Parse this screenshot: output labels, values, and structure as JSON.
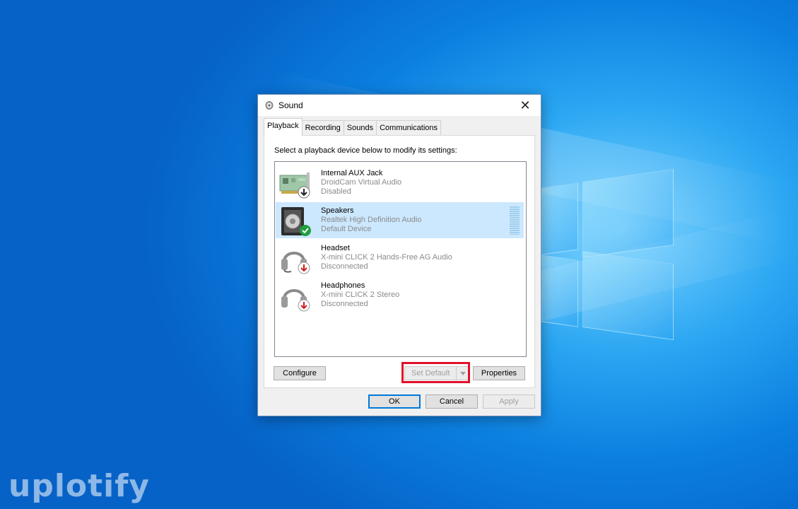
{
  "window": {
    "title": "Sound",
    "close_glyph": "✕"
  },
  "tabs": [
    {
      "label": "Playback",
      "active": true
    },
    {
      "label": "Recording",
      "active": false
    },
    {
      "label": "Sounds",
      "active": false
    },
    {
      "label": "Communications",
      "active": false
    }
  ],
  "instruction": "Select a playback device below to modify its settings:",
  "devices": [
    {
      "name": "Internal AUX Jack",
      "driver": "DroidCam Virtual Audio",
      "status": "Disabled",
      "icon": "sound-card-icon",
      "badge": "down-arrow-badge"
    },
    {
      "name": "Speakers",
      "driver": "Realtek High Definition Audio",
      "status": "Default Device",
      "icon": "speaker-icon",
      "badge": "green-check-badge",
      "selected": true
    },
    {
      "name": "Headset",
      "driver": "X-mini CLICK 2 Hands-Free AG Audio",
      "status": "Disconnected",
      "icon": "headset-icon",
      "badge": "red-down-arrow-badge"
    },
    {
      "name": "Headphones",
      "driver": "X-mini CLICK 2 Stereo",
      "status": "Disconnected",
      "icon": "headphones-icon",
      "badge": "red-down-arrow-badge"
    }
  ],
  "buttons": {
    "configure": "Configure",
    "set_default": "Set Default",
    "properties": "Properties",
    "ok": "OK",
    "cancel": "Cancel",
    "apply": "Apply"
  },
  "watermark": "uplotify",
  "colors": {
    "selection": "#cce8ff",
    "highlight": "#e2102a",
    "accent": "#0078d7"
  }
}
